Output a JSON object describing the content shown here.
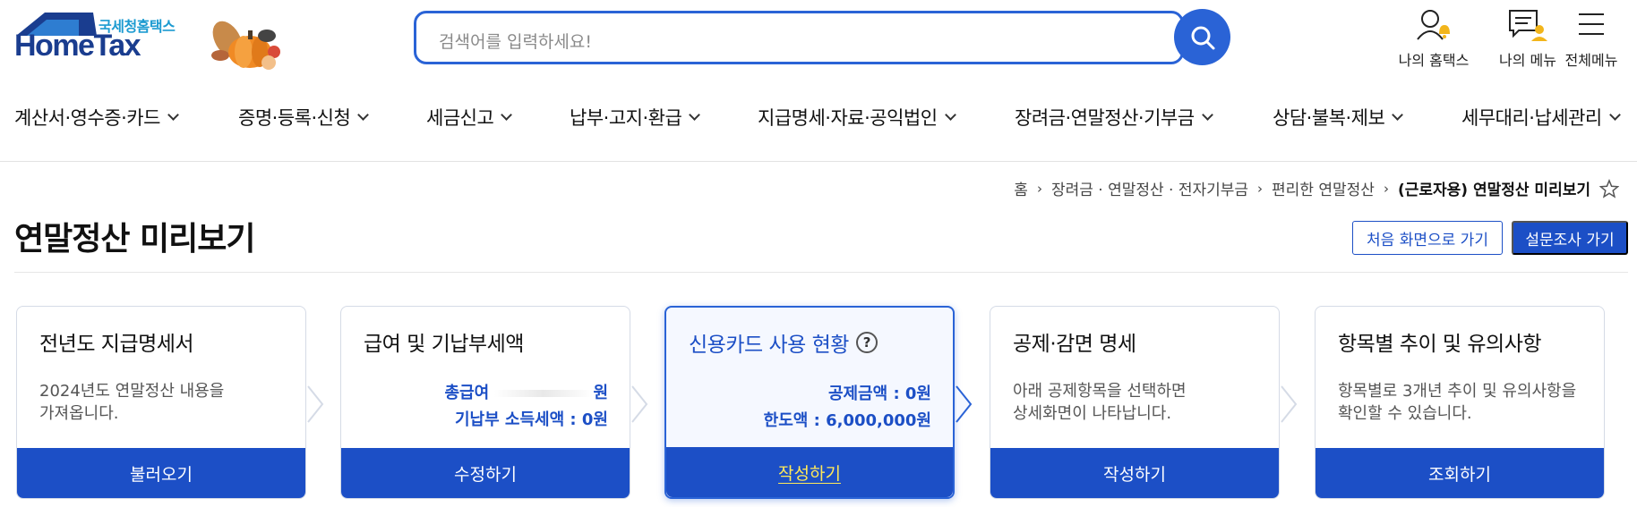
{
  "logo": {
    "sub": "국세청홈택스",
    "main": "HomeTax"
  },
  "search": {
    "placeholder": "검색어를 입력하세요!"
  },
  "utilities": [
    {
      "label": "나의 홈택스",
      "icon": "user-bell-icon"
    },
    {
      "label": "나의 메뉴",
      "icon": "menu-person-icon"
    },
    {
      "label": "전체메뉴",
      "icon": "hamburger-icon"
    }
  ],
  "gnb": [
    "계산서·영수증·카드",
    "증명·등록·신청",
    "세금신고",
    "납부·고지·환급",
    "지급명세·자료·공익법인",
    "장려금·연말정산·기부금",
    "상담·불복·제보",
    "세무대리·납세관리"
  ],
  "breadcrumb": [
    "홈",
    "장려금 · 연말정산 · 전자기부금",
    "편리한 연말정산",
    "(근로자용) 연말정산 미리보기"
  ],
  "page": {
    "title": "연말정산 미리보기",
    "btn_home": "처음 화면으로 가기",
    "btn_survey": "설문조사 가기"
  },
  "cards": [
    {
      "title": "전년도 지급명세서",
      "desc1": "2024년도 연말정산 내용을",
      "desc2": "가져옵니다.",
      "button": "불러오기"
    },
    {
      "title": "급여 및 기납부세액",
      "line1_label": "총급여",
      "line1_suffix": "원",
      "line2": "기납부 소득세액 : 0원",
      "button": "수정하기"
    },
    {
      "title": "신용카드 사용 현황",
      "help": "?",
      "line1": "공제금액 : 0원",
      "line2": "한도액 : 6,000,000원",
      "button": "작성하기"
    },
    {
      "title": "공제·감면 명세",
      "desc1": "아래 공제항목을 선택하면",
      "desc2": "상세화면이 나타납니다.",
      "button": "작성하기"
    },
    {
      "title": "항목별 추이 및 유의사항",
      "desc1": "항목별로 3개년 추이 및 유의사항을",
      "desc2": "확인할 수 있습니다.",
      "button": "조회하기"
    }
  ],
  "colors": {
    "brand_blue": "#1c4fc6",
    "search_blue": "#2a63d6",
    "highlight_yellow": "#ffe95a"
  }
}
